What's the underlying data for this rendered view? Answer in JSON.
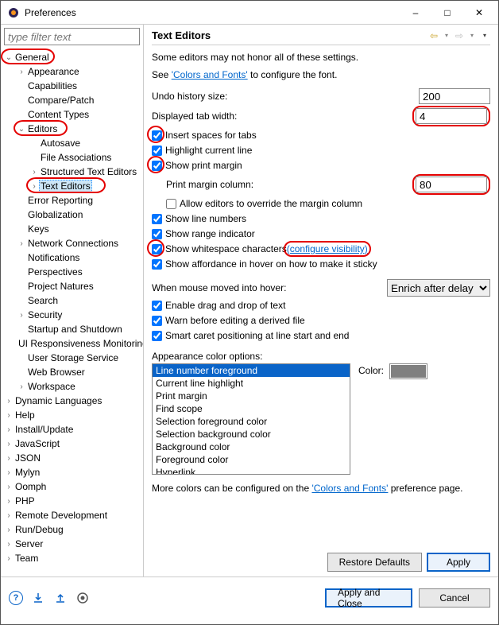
{
  "window": {
    "title": "Preferences"
  },
  "sidebar": {
    "filter_placeholder": "type filter text",
    "items": [
      {
        "label": "General",
        "depth": 0,
        "exp": "open"
      },
      {
        "label": "Appearance",
        "depth": 1,
        "exp": "closed"
      },
      {
        "label": "Capabilities",
        "depth": 1,
        "exp": ""
      },
      {
        "label": "Compare/Patch",
        "depth": 1,
        "exp": ""
      },
      {
        "label": "Content Types",
        "depth": 1,
        "exp": ""
      },
      {
        "label": "Editors",
        "depth": 1,
        "exp": "open"
      },
      {
        "label": "Autosave",
        "depth": 2,
        "exp": ""
      },
      {
        "label": "File Associations",
        "depth": 2,
        "exp": ""
      },
      {
        "label": "Structured Text Editors",
        "depth": 2,
        "exp": "closed"
      },
      {
        "label": "Text Editors",
        "depth": 2,
        "exp": "closed",
        "selected": true
      },
      {
        "label": "Error Reporting",
        "depth": 1,
        "exp": ""
      },
      {
        "label": "Globalization",
        "depth": 1,
        "exp": ""
      },
      {
        "label": "Keys",
        "depth": 1,
        "exp": ""
      },
      {
        "label": "Network Connections",
        "depth": 1,
        "exp": "closed"
      },
      {
        "label": "Notifications",
        "depth": 1,
        "exp": ""
      },
      {
        "label": "Perspectives",
        "depth": 1,
        "exp": ""
      },
      {
        "label": "Project Natures",
        "depth": 1,
        "exp": ""
      },
      {
        "label": "Search",
        "depth": 1,
        "exp": ""
      },
      {
        "label": "Security",
        "depth": 1,
        "exp": "closed"
      },
      {
        "label": "Startup and Shutdown",
        "depth": 1,
        "exp": ""
      },
      {
        "label": "UI Responsiveness Monitoring",
        "depth": 1,
        "exp": ""
      },
      {
        "label": "User Storage Service",
        "depth": 1,
        "exp": ""
      },
      {
        "label": "Web Browser",
        "depth": 1,
        "exp": ""
      },
      {
        "label": "Workspace",
        "depth": 1,
        "exp": "closed"
      },
      {
        "label": "Dynamic Languages",
        "depth": 0,
        "exp": "closed"
      },
      {
        "label": "Help",
        "depth": 0,
        "exp": "closed"
      },
      {
        "label": "Install/Update",
        "depth": 0,
        "exp": "closed"
      },
      {
        "label": "JavaScript",
        "depth": 0,
        "exp": "closed"
      },
      {
        "label": "JSON",
        "depth": 0,
        "exp": "closed"
      },
      {
        "label": "Mylyn",
        "depth": 0,
        "exp": "closed"
      },
      {
        "label": "Oomph",
        "depth": 0,
        "exp": "closed"
      },
      {
        "label": "PHP",
        "depth": 0,
        "exp": "closed"
      },
      {
        "label": "Remote Development",
        "depth": 0,
        "exp": "closed"
      },
      {
        "label": "Run/Debug",
        "depth": 0,
        "exp": "closed"
      },
      {
        "label": "Server",
        "depth": 0,
        "exp": "closed"
      },
      {
        "label": "Team",
        "depth": 0,
        "exp": "closed"
      }
    ]
  },
  "main": {
    "title": "Text Editors",
    "note": "Some editors may not honor all of these settings.",
    "see_prefix": "See ",
    "see_link": "'Colors and Fonts'",
    "see_suffix": " to configure the font.",
    "undo_label": "Undo history size:",
    "undo_value": "200",
    "tabwidth_label": "Displayed tab width:",
    "tabwidth_value": "4",
    "chk_insert_spaces": "Insert spaces for tabs",
    "chk_highlight_line": "Highlight current line",
    "chk_show_margin": "Show print margin",
    "margin_col_label": "Print margin column:",
    "margin_col_value": "80",
    "chk_allow_override": "Allow editors to override the margin column",
    "chk_line_numbers": "Show line numbers",
    "chk_range_indicator": "Show range indicator",
    "chk_whitespace": "Show whitespace characters ",
    "whitespace_link": "(configure visibility)",
    "chk_affordance": "Show affordance in hover on how to make it sticky",
    "hover_label": "When mouse moved into hover:",
    "hover_value": "Enrich after delay",
    "chk_dragdrop": "Enable drag and drop of text",
    "chk_warn_derived": "Warn before editing a derived file",
    "chk_smart_caret": "Smart caret positioning at line start and end",
    "appearance_label": "Appearance color options:",
    "color_label": "Color:",
    "color_options": [
      "Line number foreground",
      "Current line highlight",
      "Print margin",
      "Find scope",
      "Selection foreground color",
      "Selection background color",
      "Background color",
      "Foreground color",
      "Hyperlink"
    ],
    "more_colors_prefix": "More colors can be configured on the ",
    "more_colors_link": "'Colors and Fonts'",
    "more_colors_suffix": " preference page.",
    "btn_restore": "Restore Defaults",
    "btn_apply": "Apply"
  },
  "footer": {
    "btn_apply_close": "Apply and Close",
    "btn_cancel": "Cancel"
  }
}
